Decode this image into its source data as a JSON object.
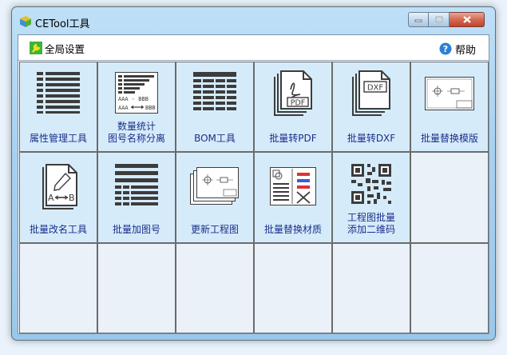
{
  "window": {
    "title": "CETool工具"
  },
  "titlebar_buttons": {
    "minimize": "minimize-icon",
    "maximize": "maximize-icon",
    "close": "close-icon"
  },
  "menu": {
    "global_settings": "全局设置",
    "help": "帮助"
  },
  "tiles": [
    {
      "label": "属性管理工具",
      "icon": "list-icon"
    },
    {
      "label": "数量统计\n图号名称分离",
      "icon": "bar-list-icon"
    },
    {
      "label": "BOM工具",
      "icon": "table-icon"
    },
    {
      "label": "批量转PDF",
      "icon": "pdf-icon"
    },
    {
      "label": "批量转DXF",
      "icon": "dxf-icon"
    },
    {
      "label": "批量替换模版",
      "icon": "drawing-template-icon"
    },
    {
      "label": "批量改名工具",
      "icon": "rename-file-icon"
    },
    {
      "label": "批量加图号",
      "icon": "numbered-list-icon"
    },
    {
      "label": "更新工程图",
      "icon": "drawing-stack-icon"
    },
    {
      "label": "批量替换材质",
      "icon": "material-icon"
    },
    {
      "label": "工程图批量\n添加二维码",
      "icon": "qr-code-icon"
    }
  ],
  "colors": {
    "tile_bg": "#d6ebfa",
    "empty_bg": "#eaf1f9",
    "label": "#1a2f8a",
    "grid_line": "#6b6b6b"
  }
}
